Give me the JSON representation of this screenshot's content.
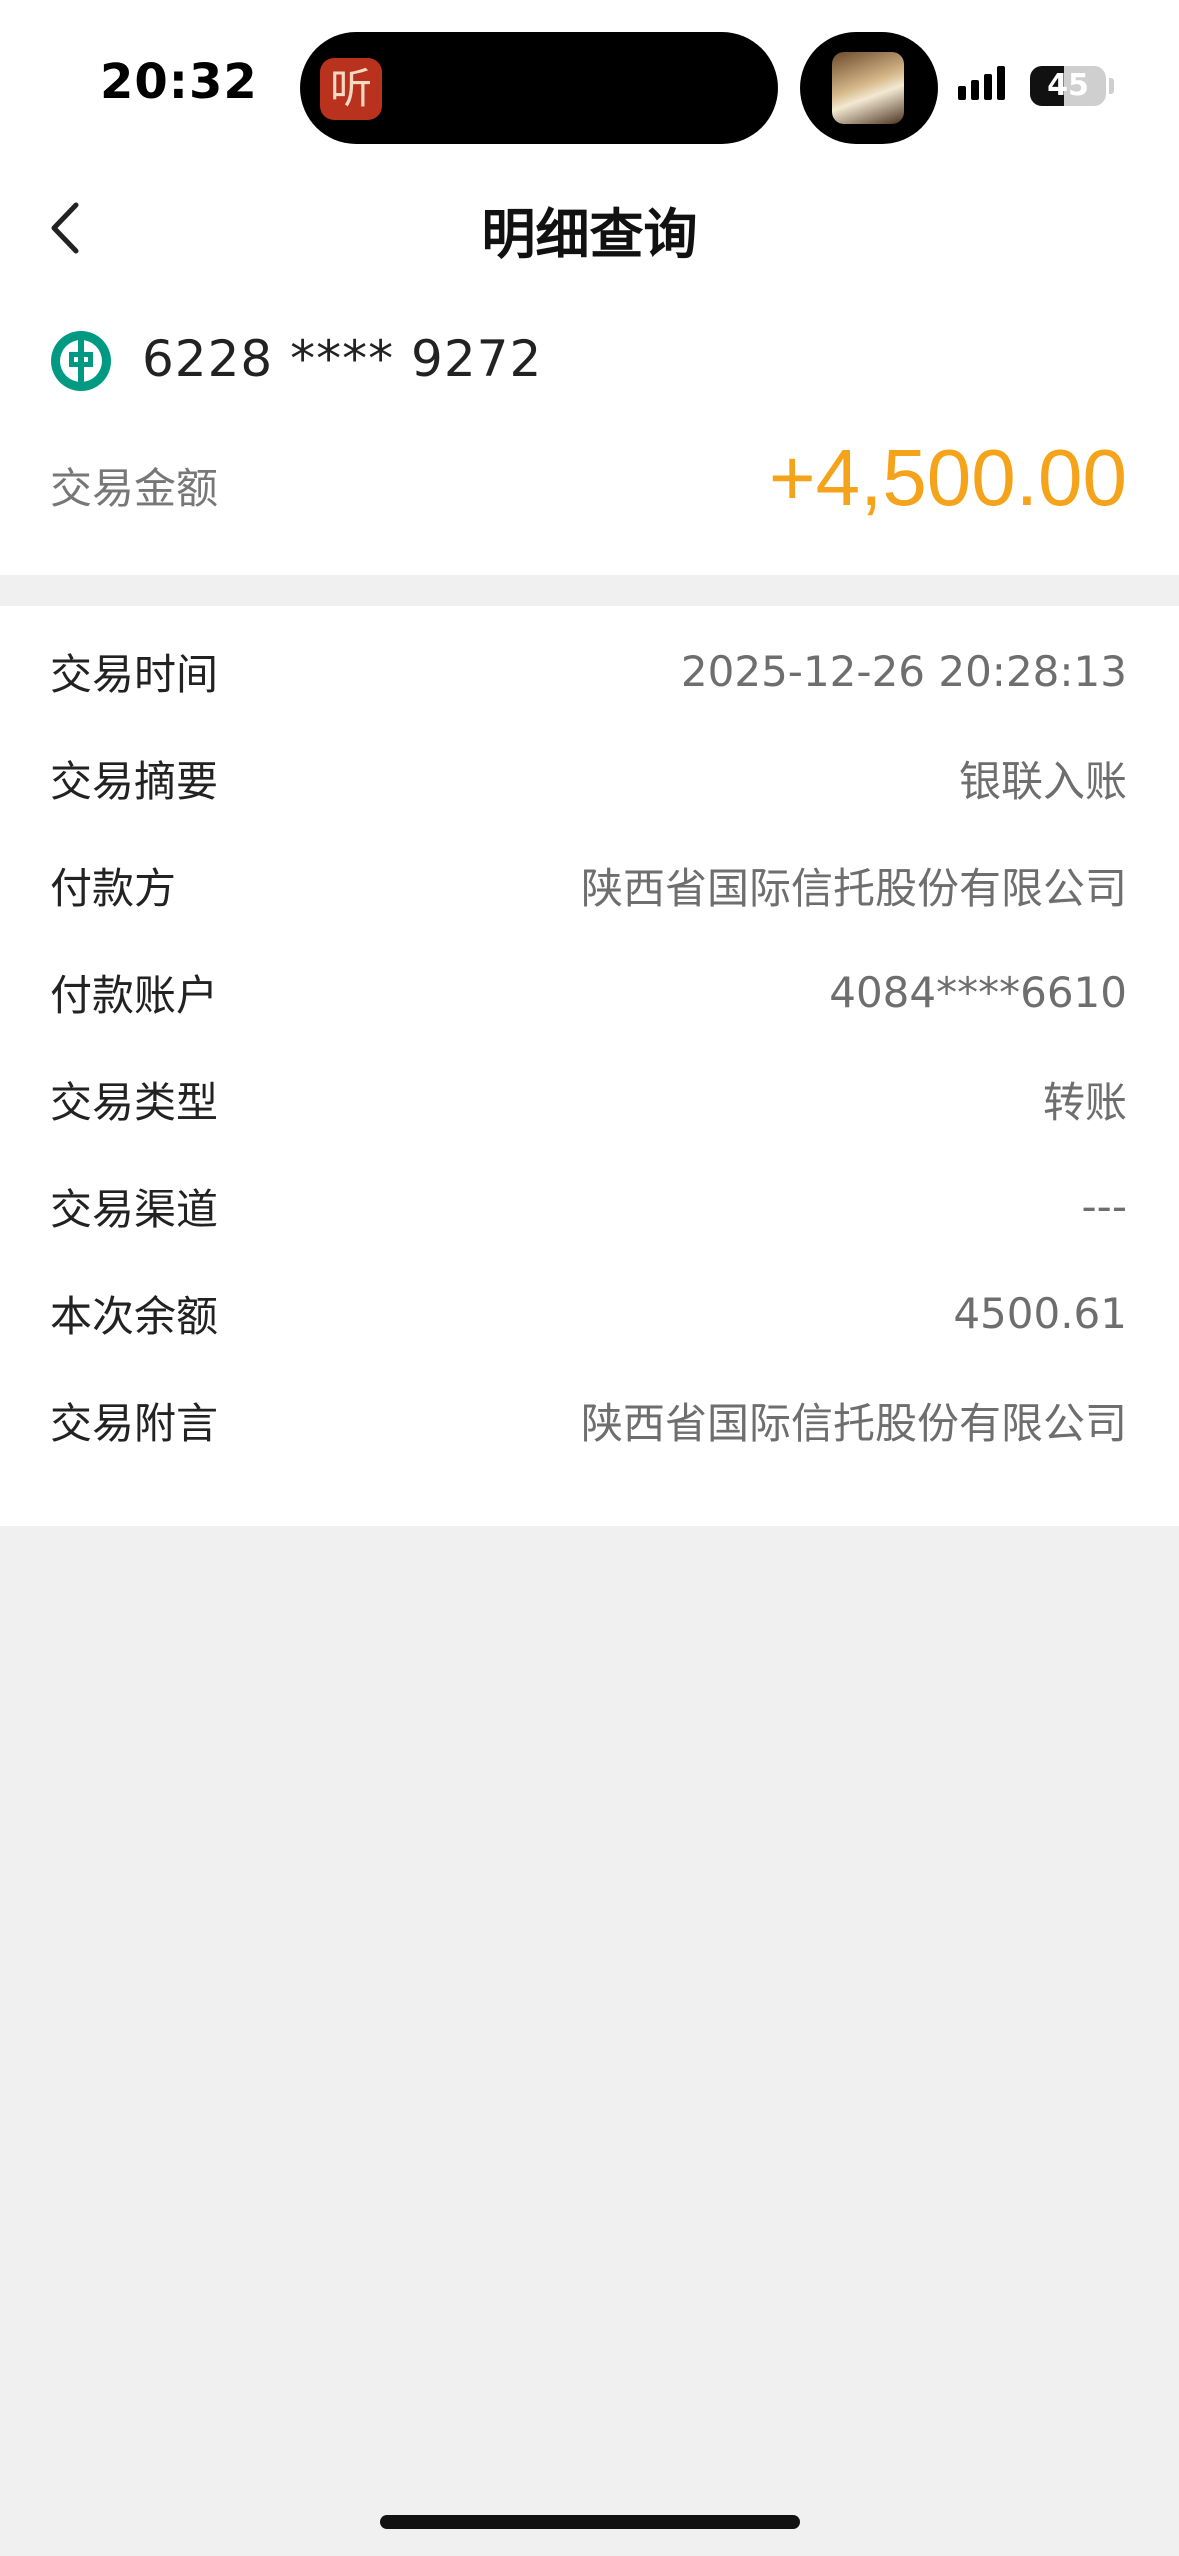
{
  "status_bar": {
    "time": "20:32",
    "battery": "45",
    "battery_level": 0.45,
    "listen_glyph": "听"
  },
  "header": {
    "title": "明细查询",
    "back_icon": "chevron-left-icon"
  },
  "summary": {
    "card_number": "6228 **** 9272",
    "amount_label": "交易金额",
    "amount": "+4,500.00",
    "amount_color": "#f5a31b",
    "bank_logo_color": "#009a82"
  },
  "details": [
    {
      "label": "交易时间",
      "value": "2025-12-26 20:28:13"
    },
    {
      "label": "交易摘要",
      "value": "银联入账"
    },
    {
      "label": "付款方",
      "value": "陕西省国际信托股份有限公司"
    },
    {
      "label": "付款账户",
      "value": "4084****6610"
    },
    {
      "label": "交易类型",
      "value": "转账"
    },
    {
      "label": "交易渠道",
      "value": "---"
    },
    {
      "label": "本次余额",
      "value": "4500.61"
    },
    {
      "label": "交易附言",
      "value": "陕西省国际信托股份有限公司"
    }
  ]
}
